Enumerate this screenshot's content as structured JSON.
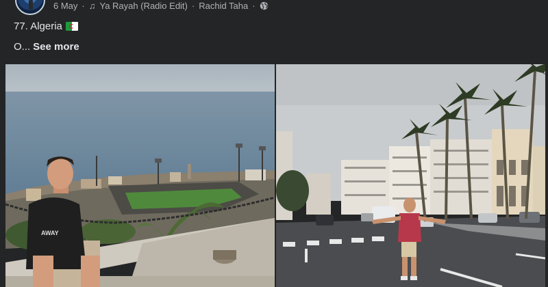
{
  "post": {
    "date": "6 May",
    "dot1": "·",
    "song": "Ya Rayah (Radio Edit)",
    "dot2": "·",
    "artist": "Rachid Taha",
    "dot3": "·",
    "caption_text": "77. Algeria",
    "truncated_text": "O...",
    "see_more_label": "See more"
  },
  "icons": {
    "music": "music-note-icon",
    "privacy": "globe-icon",
    "flag": "algeria-flag-icon"
  },
  "colors": {
    "background": "#242526",
    "primary_text": "#e4e6eb",
    "secondary_text": "#b0b3b8"
  }
}
